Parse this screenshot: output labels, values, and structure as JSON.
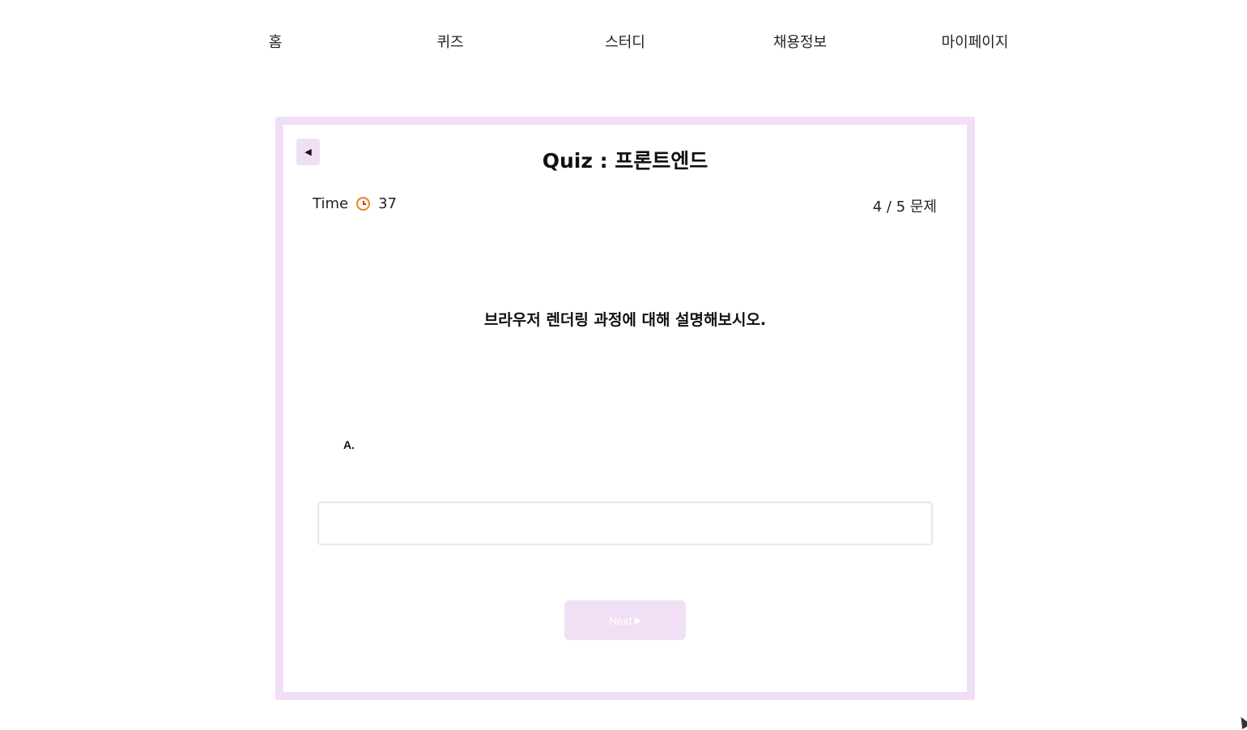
{
  "nav": {
    "items": [
      {
        "label": "홈"
      },
      {
        "label": "퀴즈"
      },
      {
        "label": "스터디"
      },
      {
        "label": "채용정보"
      },
      {
        "label": "마이페이지"
      }
    ]
  },
  "quiz": {
    "back_icon": "◀",
    "title": "Quiz : 프론트엔드",
    "timer_label": "Time",
    "timer_icon": "alarm-clock",
    "timer_value": "37",
    "progress": "4 / 5 문제",
    "question": "브라우저 렌더링 과정에 대해 설명해보시오.",
    "answer_label": "A.",
    "answer_value": "",
    "answer_placeholder": "",
    "next_label": "Next",
    "next_icon": "▶"
  },
  "colors": {
    "accent": "#f1e0f5",
    "text": "#111111",
    "background": "#ffffff"
  }
}
